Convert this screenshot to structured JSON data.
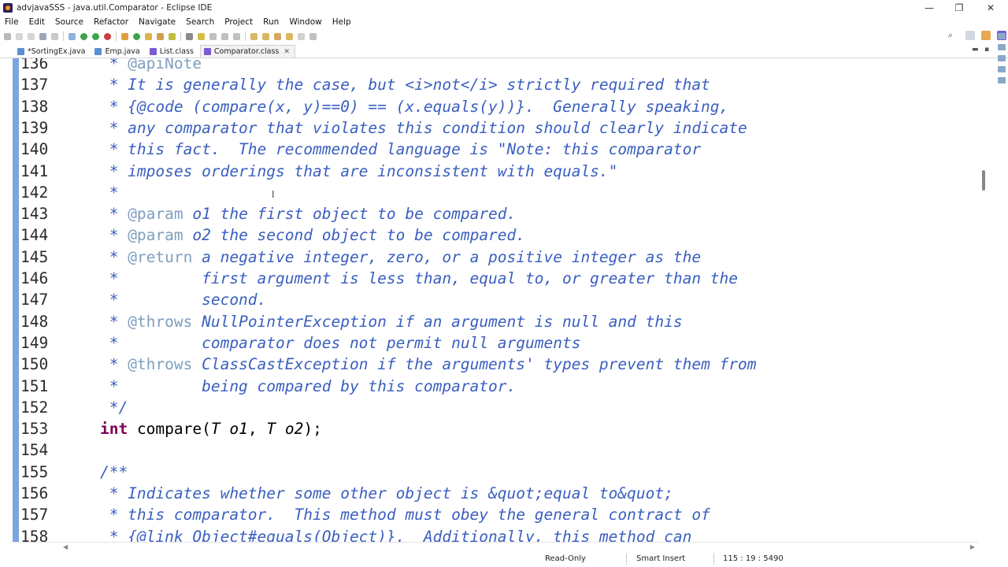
{
  "window": {
    "title": "advjavaSSS - java.util.Comparator - Eclipse IDE",
    "minimize": "—",
    "maximize": "❐",
    "close": "✕"
  },
  "menu": [
    "File",
    "Edit",
    "Source",
    "Refactor",
    "Navigate",
    "Search",
    "Project",
    "Run",
    "Window",
    "Help"
  ],
  "tabs": [
    {
      "label": "*SortingEx.java",
      "active": false
    },
    {
      "label": "Emp.java",
      "active": false
    },
    {
      "label": "List.class",
      "active": false
    },
    {
      "label": "Comparator.class",
      "active": true,
      "close": "✕"
    }
  ],
  "editor": {
    "lines": [
      {
        "no": "136",
        "text": "     * @apiNote"
      },
      {
        "no": "137",
        "text": "     * It is generally the case, but <i>not</i> strictly required that"
      },
      {
        "no": "138",
        "text": "     * {@code (compare(x, y)==0) == (x.equals(y))}.  Generally speaking,"
      },
      {
        "no": "139",
        "text": "     * any comparator that violates this condition should clearly indicate"
      },
      {
        "no": "140",
        "text": "     * this fact.  The recommended language is \"Note: this comparator"
      },
      {
        "no": "141",
        "text": "     * imposes orderings that are inconsistent with equals.\""
      },
      {
        "no": "142",
        "text": "     *"
      },
      {
        "no": "143",
        "text": "     * @param o1 the first object to be compared."
      },
      {
        "no": "144",
        "text": "     * @param o2 the second object to be compared."
      },
      {
        "no": "145",
        "text": "     * @return a negative integer, zero, or a positive integer as the"
      },
      {
        "no": "146",
        "text": "     *         first argument is less than, equal to, or greater than the"
      },
      {
        "no": "147",
        "text": "     *         second."
      },
      {
        "no": "148",
        "text": "     * @throws NullPointerException if an argument is null and this"
      },
      {
        "no": "149",
        "text": "     *         comparator does not permit null arguments"
      },
      {
        "no": "150",
        "text": "     * @throws ClassCastException if the arguments' types prevent them from"
      },
      {
        "no": "151",
        "text": "     *         being compared by this comparator."
      },
      {
        "no": "152",
        "text": "     */"
      },
      {
        "no": "153",
        "text": "    int compare(T o1, T o2);"
      },
      {
        "no": "154",
        "text": ""
      },
      {
        "no": "155",
        "text": "    /**"
      },
      {
        "no": "156",
        "text": "     * Indicates whether some other object is &quot;equal to&quot;"
      },
      {
        "no": "157",
        "text": "     * this comparator.  This method must obey the general contract of"
      },
      {
        "no": "158",
        "text": "     * {@link Object#equals(Object)}.  Additionally, this method can"
      }
    ]
  },
  "status": {
    "mode": "Read-Only",
    "insert": "Smart Insert",
    "position": "115 : 19 : 5490"
  },
  "colors": {
    "comment": "#3a5fbf",
    "javadoc_tag": "#7f9fbf",
    "keyword": "#7f0055",
    "ruler": "#5b8fd8"
  }
}
